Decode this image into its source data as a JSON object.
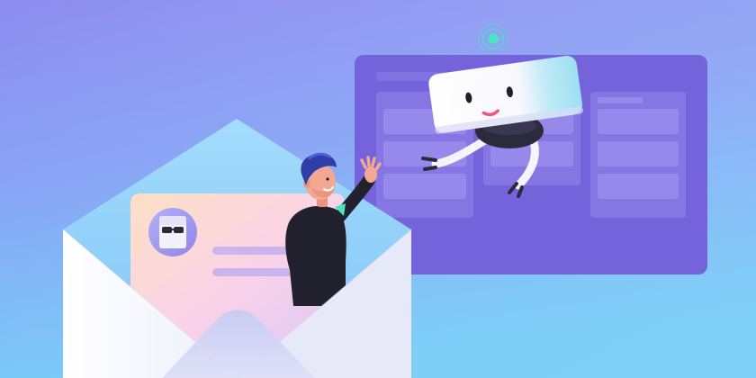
{
  "illustration": {
    "kind": "decorative banner",
    "texts": []
  },
  "palette": {
    "background_top": "#8e8cf0",
    "background_bottom": "#63c4f6",
    "board": "#7662dc",
    "board_column": "#8a79e6",
    "board_card": "#9b8cec",
    "envelope_back": "#93d3fb",
    "envelope_front": "#eef2fb",
    "letter": "#fbd9e5",
    "robot_body": "#fafafe",
    "robot_head_side": "#a7e6f4",
    "signal": "#4ce3c4",
    "person_jacket": "#22222e",
    "person_hair": "#2e3ca7",
    "person_skin": "#f3a893"
  },
  "icons": {
    "avatar": "sunglasses-avatar-icon",
    "signal": "signal-beacon-icon"
  }
}
